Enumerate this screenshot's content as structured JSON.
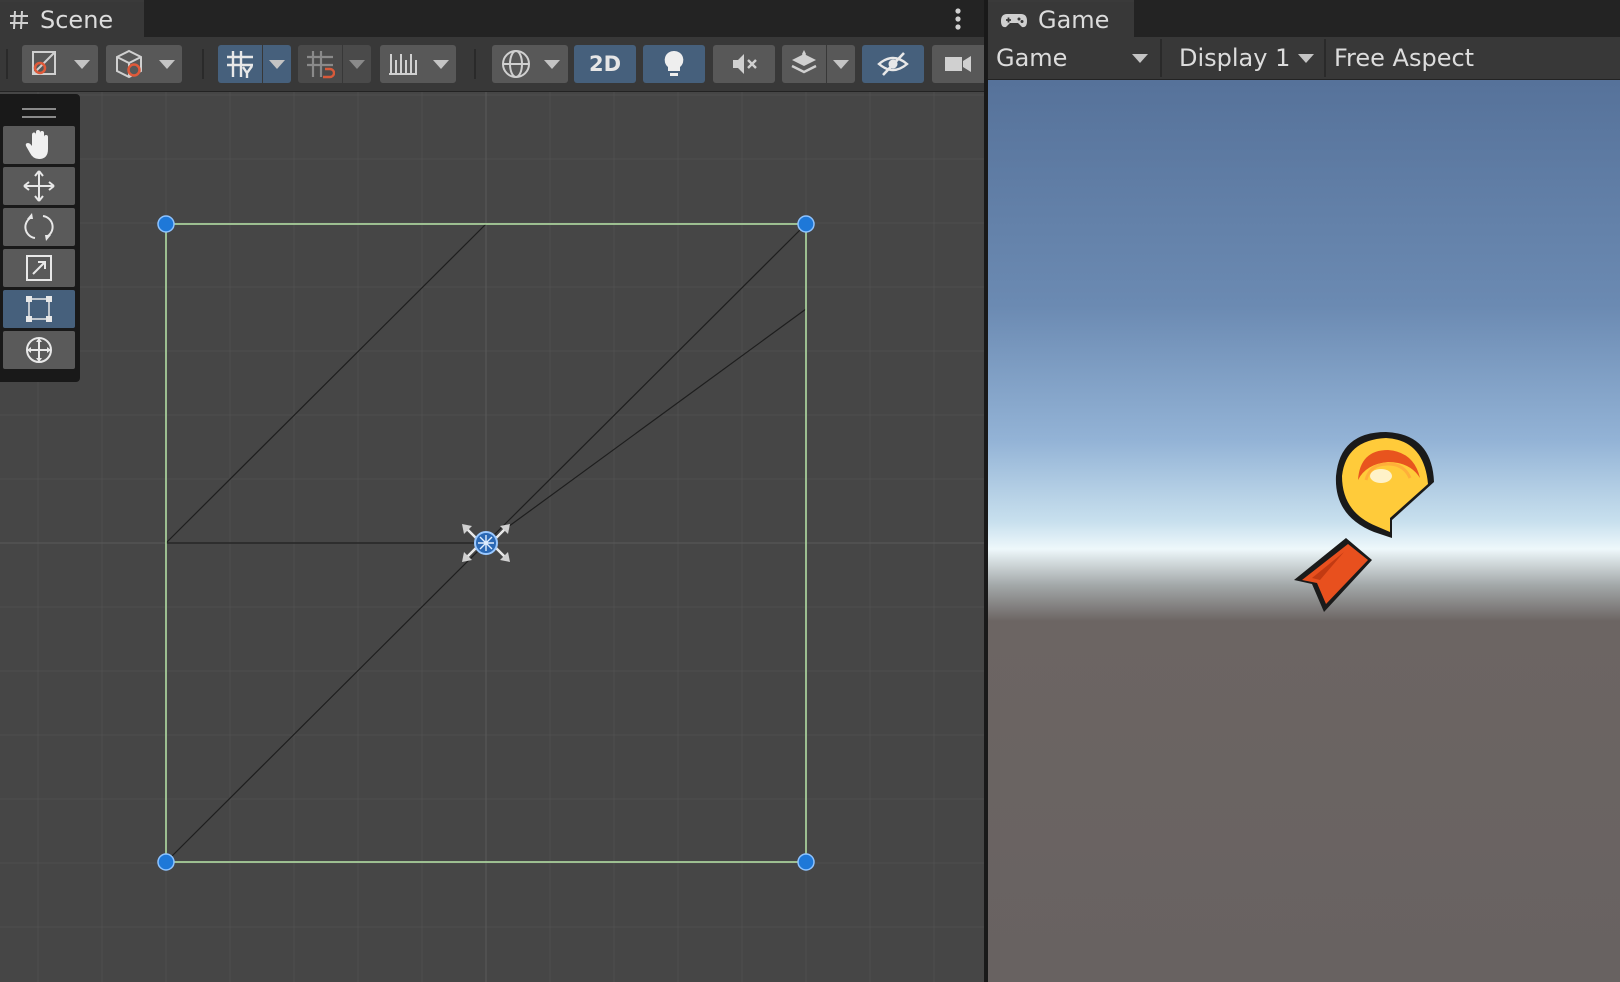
{
  "scene": {
    "tab_label": "Scene",
    "tab_icon": "grid-hash-icon",
    "mode_2d_label": "2D",
    "toolbar_icons": [
      "draw-mode-icon",
      "shading-cube-icon",
      "grid-snap-icon",
      "increment-snap-icon",
      "ruler-icon",
      "gizmo-globe-icon",
      "lightbulb-icon",
      "audio-mute-icon",
      "effects-layers-icon",
      "visibility-icon",
      "camera-icon"
    ],
    "tools": [
      "hand-tool-icon",
      "move-tool-icon",
      "rotate-tool-icon",
      "scale-tool-icon",
      "rect-tool-icon",
      "transform-tool-icon"
    ],
    "active_tool": "rect-tool-icon"
  },
  "game": {
    "tab_label": "Game",
    "tab_icon": "gamepad-icon",
    "view_dropdown": "Game",
    "display_dropdown": "Display 1",
    "aspect_dropdown": "Free Aspect"
  },
  "colors": {
    "accent_active": "#46607c",
    "rect_outline": "#b8e6a8",
    "handle_blue": "#1e78d8",
    "medal_gold": "#ffcb3a",
    "ribbon_red": "#e8501e"
  }
}
